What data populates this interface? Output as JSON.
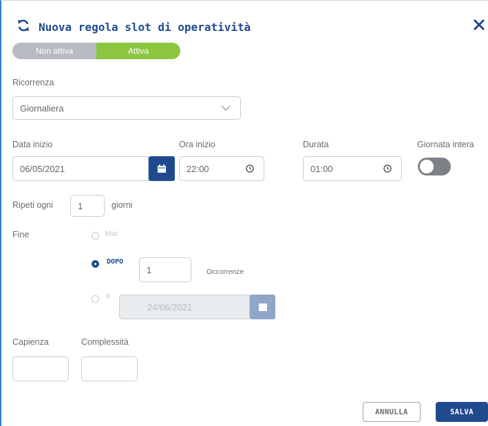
{
  "dialog": {
    "title": "Nuova regola slot di operatività",
    "status_toggle": {
      "off_label": "Non attiva",
      "on_label": "Attiva",
      "selected": "Attiva"
    }
  },
  "recurrence": {
    "label": "Ricorrenza",
    "value": "Giornaliera"
  },
  "start_date": {
    "label": "Data inizio",
    "value": "06/05/2021"
  },
  "start_time": {
    "label": "Ora inizio",
    "value": "22:00"
  },
  "duration": {
    "label": "Durata",
    "value": "01:00"
  },
  "full_day": {
    "label": "Giornata intera",
    "checked": false
  },
  "repeat": {
    "prefix": "Ripeti ogni",
    "value": "1",
    "suffix": "giorni"
  },
  "end": {
    "label": "Fine",
    "options": {
      "never": "Mai",
      "after": "DOPO",
      "on_date": "Il"
    },
    "selected": "DOPO",
    "after_count": "1",
    "after_suffix": "Occorrenze",
    "on_date_value": "24/06/2021"
  },
  "capacity": {
    "label": "Capienza",
    "value": ""
  },
  "complexity": {
    "label": "Complessità",
    "value": ""
  },
  "actions": {
    "cancel": "ANNULLA",
    "save": "SALVA"
  },
  "colors": {
    "primary": "#1f4b8e",
    "active_green": "#8cc63f",
    "inactive_gray": "#b8bcc2"
  }
}
